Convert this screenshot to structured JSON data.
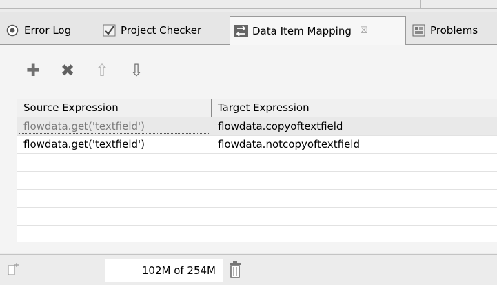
{
  "tabs": [
    {
      "label": "Error Log",
      "icon": "error-log-icon",
      "active": false
    },
    {
      "label": "Project Checker",
      "icon": "project-checker-icon",
      "active": false
    },
    {
      "label": "Data Item Mapping",
      "icon": "data-item-mapping-icon",
      "active": true,
      "close_glyph": "☒"
    },
    {
      "label": "Problems",
      "icon": "problems-icon",
      "active": false
    }
  ],
  "toolbar": {
    "buttons": [
      {
        "icon": "add-icon",
        "glyph": "✚",
        "color": "#707070"
      },
      {
        "icon": "delete-icon",
        "glyph": "✖",
        "color": "#606060"
      },
      {
        "icon": "move-up-icon",
        "glyph": "⇧",
        "color": "#b8b8b8"
      },
      {
        "icon": "move-down-icon",
        "glyph": "⇩",
        "color": "#6a6a6a"
      }
    ]
  },
  "table": {
    "columns": [
      "Source Expression",
      "Target Expression"
    ],
    "rows": [
      {
        "source": "flowdata.get('textfield')",
        "target": "flowdata.copyoftextfield"
      },
      {
        "source": "flowdata.get('textfield')",
        "target": "flowdata.notcopyoftextfield"
      }
    ]
  },
  "status": {
    "heap_used": 102,
    "heap_total": 254,
    "heap_text": "102M of 254M"
  }
}
